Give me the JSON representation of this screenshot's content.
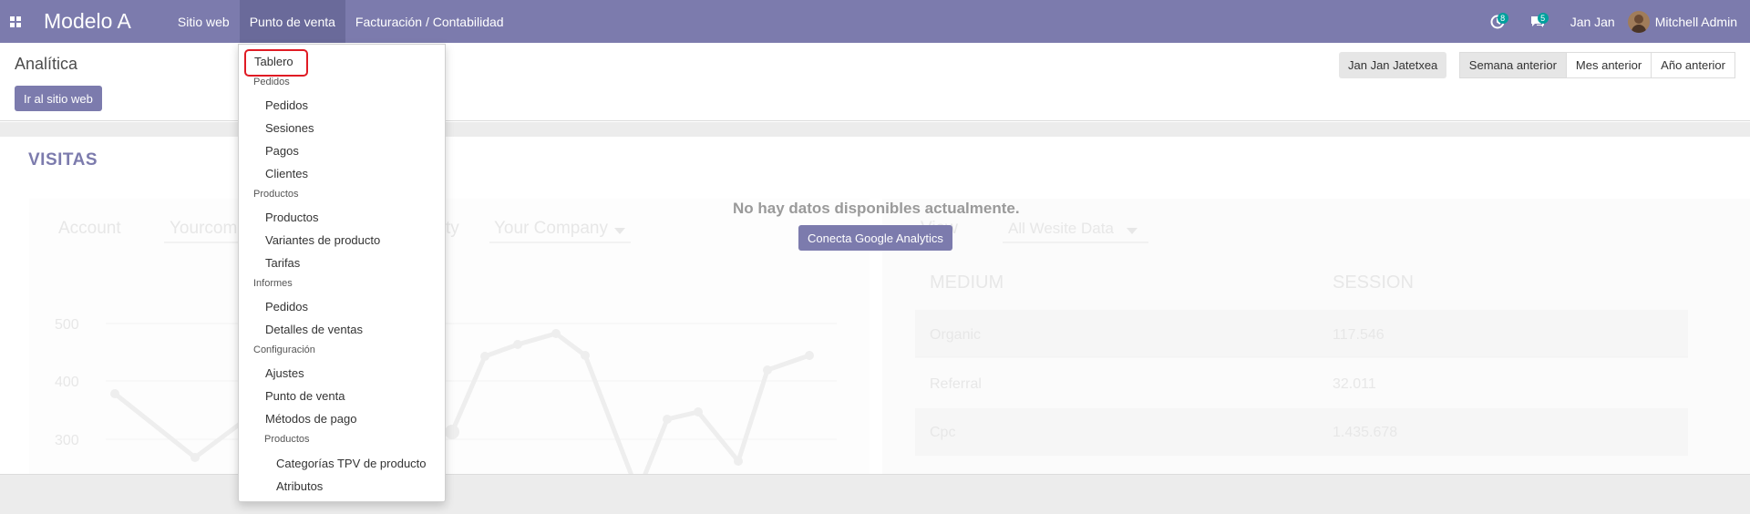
{
  "navbar": {
    "brand": "Modelo A",
    "menu": [
      "Sitio web",
      "Punto de venta",
      "Facturación / Contabilidad"
    ],
    "activity_count": "8",
    "messages_count": "5",
    "company": "Jan Jan",
    "user": "Mitchell Admin"
  },
  "control_panel": {
    "title": "Analítica",
    "go_website": "Ir al sitio web",
    "website_selector": "Jan Jan Jatetxea",
    "periods": [
      "Semana anterior",
      "Mes anterior",
      "Año anterior"
    ],
    "active_period": "Semana anterior"
  },
  "dashboard": {
    "section_title": "VISITAS",
    "no_data": "No hay datos disponibles actualmente.",
    "connect_button": "Conecta Google Analytics",
    "ghost": {
      "account_label": "Account",
      "account_value": "Yourcom",
      "property_label": "Property",
      "property_value": "Your Company",
      "view_label": "View",
      "view_value": "All Wesite Data",
      "y_ticks": [
        "500",
        "400",
        "300"
      ],
      "table_headers": [
        "MEDIUM",
        "SESSION"
      ],
      "table_rows": [
        [
          "Organic",
          "117.546"
        ],
        [
          "Referral",
          "32.011"
        ],
        [
          "Cpc",
          "1.435.678"
        ]
      ]
    }
  },
  "dropdown": {
    "items": [
      {
        "type": "item",
        "label": "Tablero",
        "level": 0
      },
      {
        "type": "header",
        "label": "Pedidos",
        "level": 0
      },
      {
        "type": "item",
        "label": "Pedidos",
        "level": 1
      },
      {
        "type": "item",
        "label": "Sesiones",
        "level": 1
      },
      {
        "type": "item",
        "label": "Pagos",
        "level": 1
      },
      {
        "type": "item",
        "label": "Clientes",
        "level": 1
      },
      {
        "type": "header",
        "label": "Productos",
        "level": 0
      },
      {
        "type": "item",
        "label": "Productos",
        "level": 1
      },
      {
        "type": "item",
        "label": "Variantes de producto",
        "level": 1
      },
      {
        "type": "item",
        "label": "Tarifas",
        "level": 1
      },
      {
        "type": "header",
        "label": "Informes",
        "level": 0
      },
      {
        "type": "item",
        "label": "Pedidos",
        "level": 1
      },
      {
        "type": "item",
        "label": "Detalles de ventas",
        "level": 1
      },
      {
        "type": "header",
        "label": "Configuración",
        "level": 0
      },
      {
        "type": "item",
        "label": "Ajustes",
        "level": 1
      },
      {
        "type": "item",
        "label": "Punto de venta",
        "level": 1
      },
      {
        "type": "item",
        "label": "Métodos de pago",
        "level": 1
      },
      {
        "type": "header",
        "label": "Productos",
        "level": 1
      },
      {
        "type": "item",
        "label": "Categorías TPV de producto",
        "level": 2
      },
      {
        "type": "item",
        "label": "Atributos",
        "level": 2
      }
    ]
  },
  "colors": {
    "brand": "#7c7bad",
    "badge": "#00a09d",
    "highlight": "#e01b24"
  }
}
